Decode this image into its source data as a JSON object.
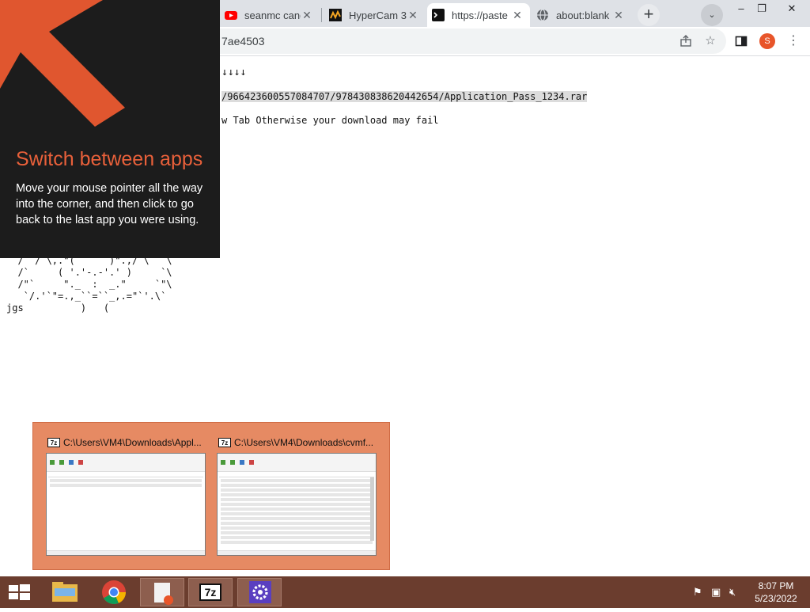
{
  "browser": {
    "tabs": [
      {
        "title": "seanmc cand",
        "favicon": "youtube-icon",
        "active": false
      },
      {
        "title": "HyperCam 3",
        "favicon": "hypercam-icon",
        "active": false
      },
      {
        "title": "https://paste",
        "favicon": "terminal-icon",
        "active": true
      },
      {
        "title": "about:blank",
        "favicon": "globe-icon",
        "active": false
      }
    ],
    "close_glyph": "✕",
    "new_tab_glyph": "+",
    "tab_search_glyph": "⌄",
    "window_controls": {
      "minimize": "–",
      "restore": "❐",
      "close": "✕"
    },
    "address": "7ae4503",
    "profile_initial": "S",
    "accent_color": "#e8552a"
  },
  "page": {
    "arrows": "↓↓↓↓",
    "download_link": "/966423600557084707/978430838620442654/Application_Pass_1234.rar",
    "warning": "w Tab Otherwise your download may fail",
    "ascii_art": "  /` /`\\,.\"(      )\".,/`\\  `\\\n  /`     ( '.'-.-'.' )     `\\\n  /\"`     \"._  :  _.\"     `\"\\\n   `/.'`\"=.,_``=``_,.=\"`'.\\`\njgs          )   ("
  },
  "tip": {
    "title": "Switch between apps",
    "body": "Move your mouse pointer all the way into the corner, and then click to go back to the last app you were using.",
    "title_color": "#e8603a"
  },
  "switcher": {
    "items": [
      {
        "title": "C:\\Users\\VM4\\Downloads\\Appl...",
        "app": "7z"
      },
      {
        "title": "C:\\Users\\VM4\\Downloads\\cvmf...",
        "app": "7z"
      }
    ]
  },
  "taskbar": {
    "apps": [
      "file-explorer-icon",
      "chrome-icon",
      "downloads-app-icon",
      "7zip-icon",
      "settings-gear-icon"
    ],
    "sevenzip_label": "7z",
    "clock_time": "8:07 PM",
    "clock_date": "5/23/2022",
    "tray": {
      "flag": "⚑",
      "network": "▣",
      "volume": "🔇︎"
    }
  }
}
